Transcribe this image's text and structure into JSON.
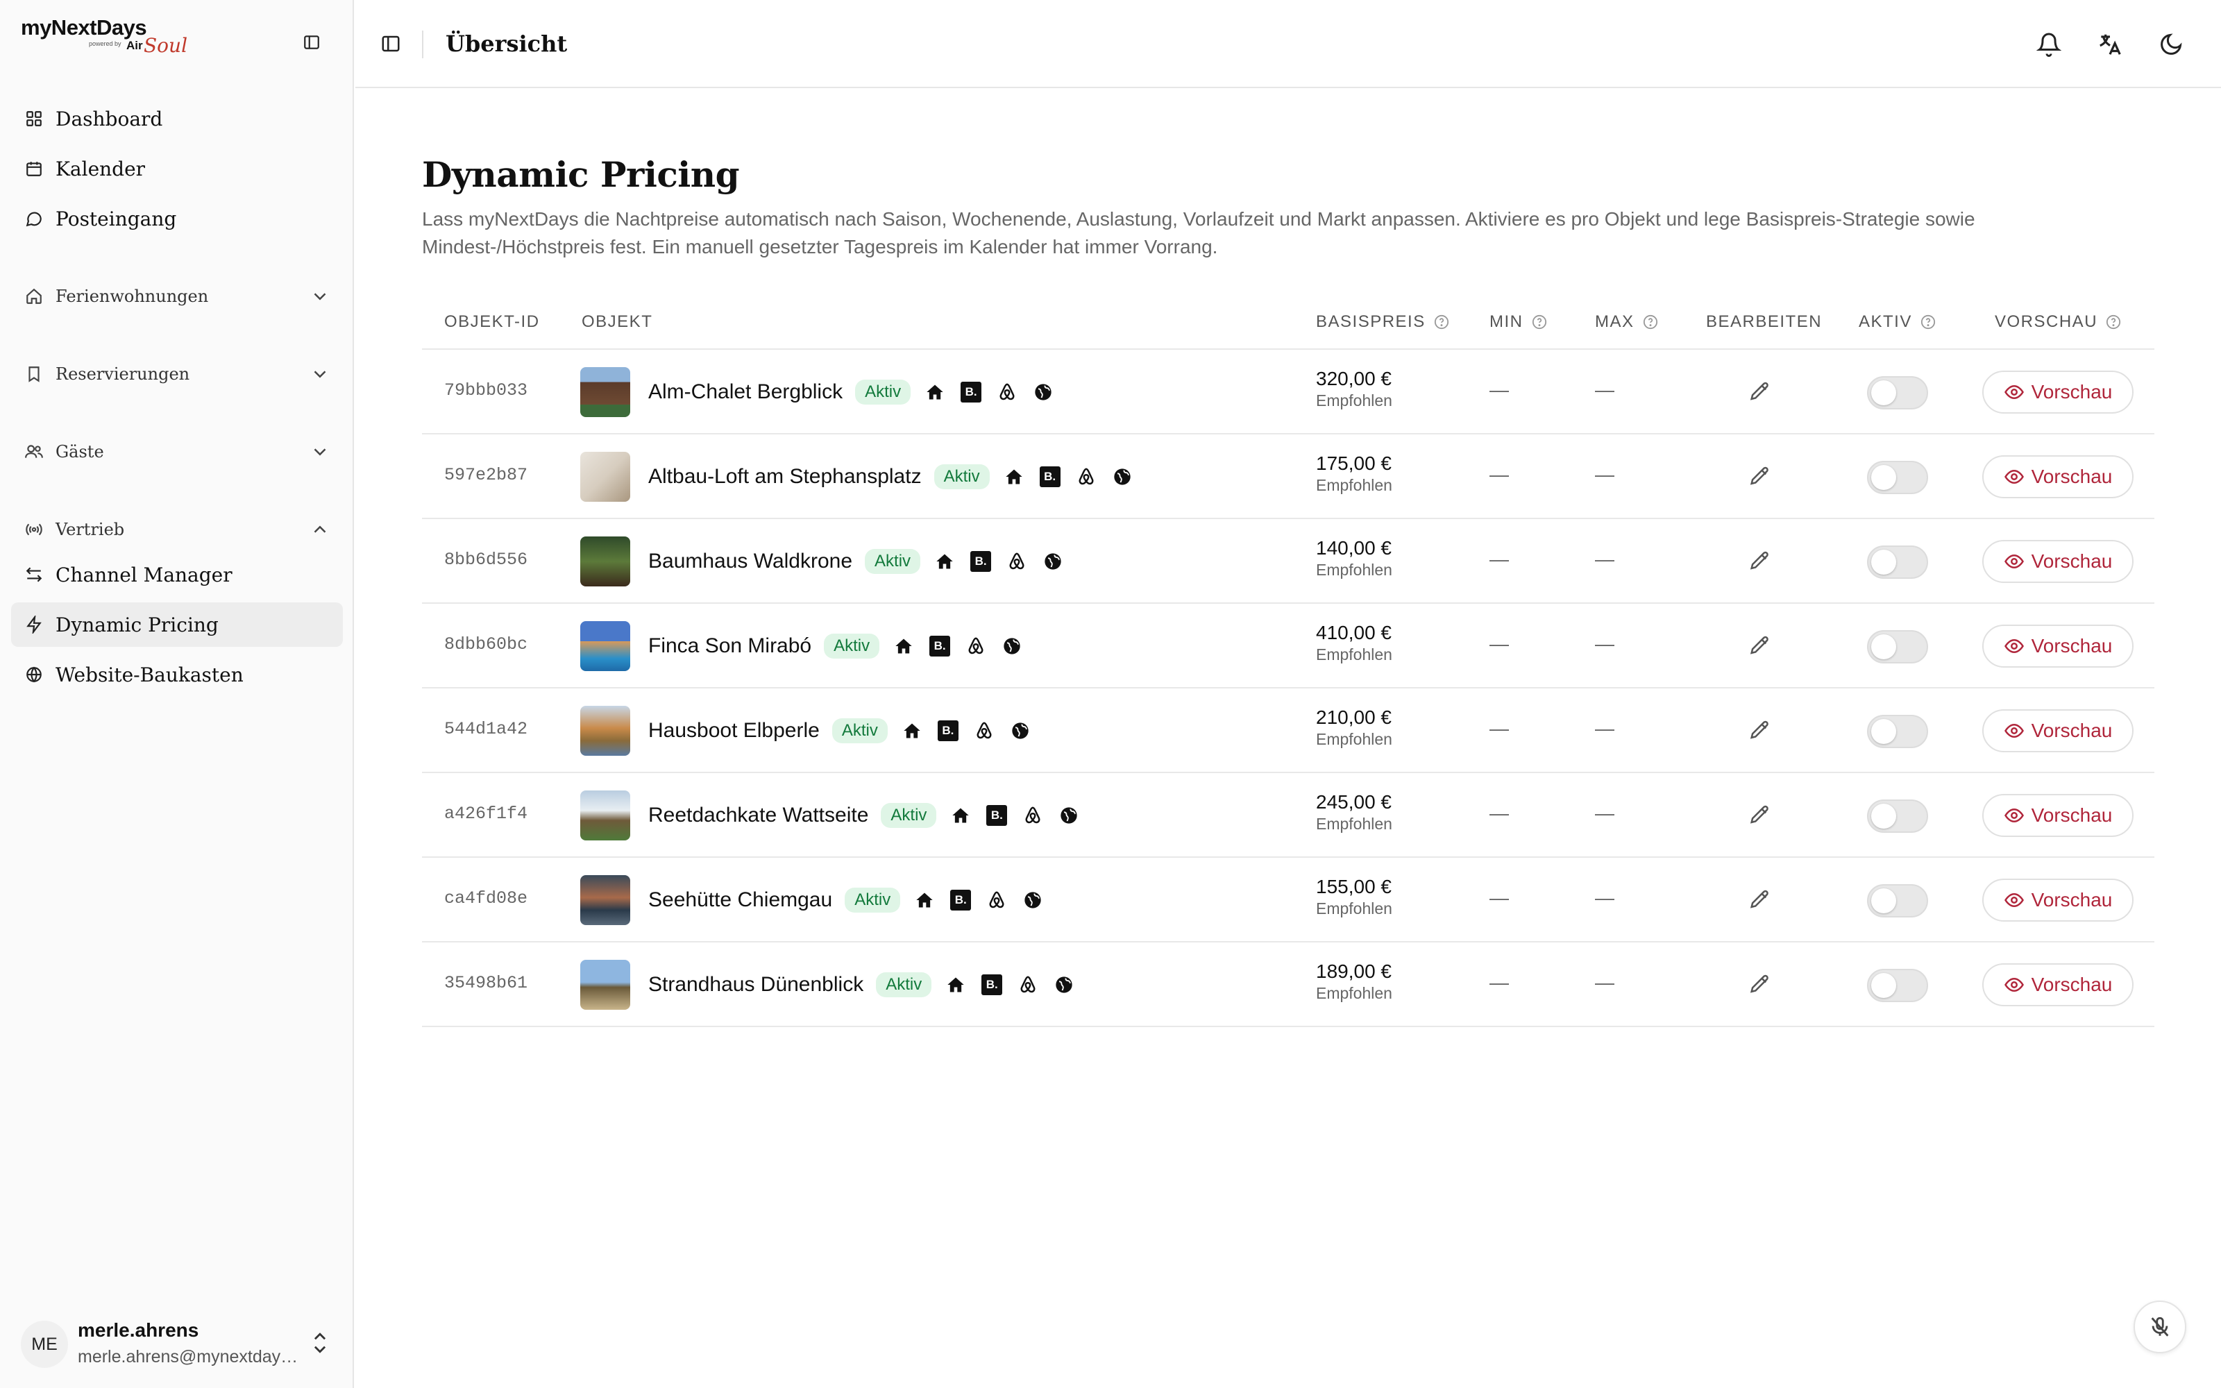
{
  "brand": {
    "name": "myNextDays",
    "powered": "powered by",
    "air": "Air",
    "soul": "Soul"
  },
  "sidebar": {
    "nav": [
      {
        "label": "Dashboard",
        "icon": "grid-icon"
      },
      {
        "label": "Kalender",
        "icon": "calendar-icon"
      },
      {
        "label": "Posteingang",
        "icon": "message-icon"
      }
    ],
    "groups": [
      {
        "label": "Ferienwohnungen",
        "icon": "home-icon",
        "expanded": false
      },
      {
        "label": "Reservierungen",
        "icon": "bookmark-icon",
        "expanded": false
      },
      {
        "label": "Gäste",
        "icon": "users-icon",
        "expanded": false
      },
      {
        "label": "Vertrieb",
        "icon": "broadcast-icon",
        "expanded": true
      }
    ],
    "sub": [
      {
        "label": "Channel Manager",
        "icon": "arrows-icon"
      },
      {
        "label": "Dynamic Pricing",
        "icon": "bolt-icon",
        "active": true
      },
      {
        "label": "Website-Baukasten",
        "icon": "globe-icon"
      }
    ]
  },
  "user": {
    "initials": "ME",
    "name": "merle.ahrens",
    "email": "merle.ahrens@mynextdays.com"
  },
  "topbar": {
    "title": "Übersicht"
  },
  "page": {
    "title": "Dynamic Pricing",
    "description": "Lass myNextDays die Nachtpreise automatisch nach Saison, Wochenende, Auslastung, Vorlaufzeit und Markt anpassen. Aktiviere es pro Objekt und lege Basispreis-Strategie sowie Mindest-/Höchstpreis fest. Ein manuell gesetzter Tagespreis im Kalender hat immer Vorrang."
  },
  "table": {
    "headers": {
      "id": "OBJEKT-ID",
      "object": "OBJEKT",
      "base": "BASISPREIS",
      "min": "MIN",
      "max": "MAX",
      "edit": "BEARBEITEN",
      "active": "AKTIV",
      "preview": "VORSCHAU"
    },
    "status_label": "Aktiv",
    "price_sub": "Empfohlen",
    "empty": "—",
    "preview_label": "Vorschau",
    "accent_color": "#b0263b",
    "badge_color": "#dff5e6",
    "rows": [
      {
        "id": "79bbb033",
        "name": "Alm-Chalet Bergblick",
        "price": "320,00 €",
        "min": "—",
        "max": "—",
        "enabled": false
      },
      {
        "id": "597e2b87",
        "name": "Altbau-Loft am Stephansplatz",
        "price": "175,00 €",
        "min": "—",
        "max": "—",
        "enabled": false
      },
      {
        "id": "8bb6d556",
        "name": "Baumhaus Waldkrone",
        "price": "140,00 €",
        "min": "—",
        "max": "—",
        "enabled": false
      },
      {
        "id": "8dbb60bc",
        "name": "Finca Son Mirabó",
        "price": "410,00 €",
        "min": "—",
        "max": "—",
        "enabled": false
      },
      {
        "id": "544d1a42",
        "name": "Hausboot Elbperle",
        "price": "210,00 €",
        "min": "—",
        "max": "—",
        "enabled": false
      },
      {
        "id": "a426f1f4",
        "name": "Reetdachkate Wattseite",
        "price": "245,00 €",
        "min": "—",
        "max": "—",
        "enabled": false
      },
      {
        "id": "ca4fd08e",
        "name": "Seehütte Chiemgau",
        "price": "155,00 €",
        "min": "—",
        "max": "—",
        "enabled": false
      },
      {
        "id": "35498b61",
        "name": "Strandhaus Dünenblick",
        "price": "189,00 €",
        "min": "—",
        "max": "—",
        "enabled": false
      }
    ]
  }
}
